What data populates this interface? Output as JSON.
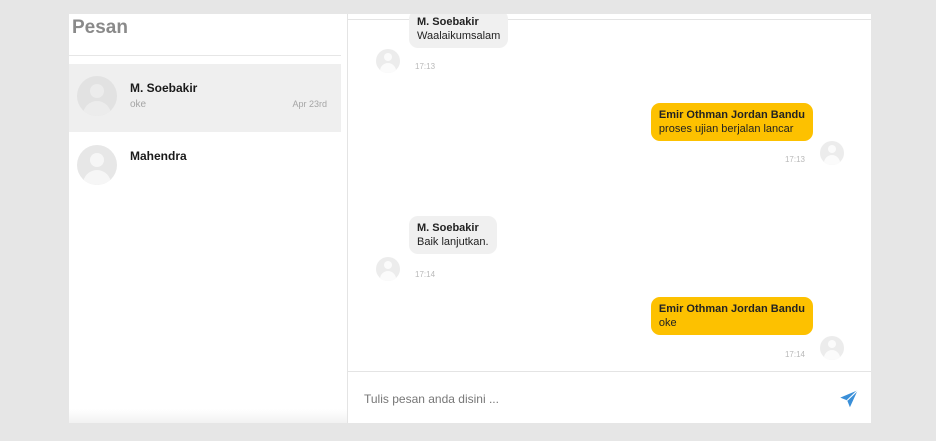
{
  "sidebar": {
    "title": "Pesan",
    "contacts": [
      {
        "name": "M. Soebakir",
        "preview": "oke",
        "date": "Apr 23rd"
      },
      {
        "name": "Mahendra",
        "preview": "",
        "date": ""
      }
    ]
  },
  "chat": {
    "messages": [
      {
        "direction": "in",
        "sender": "M. Soebakir",
        "text": "Waalaikumsalam",
        "time": "17:13"
      },
      {
        "direction": "out",
        "sender": "Emir Othman Jordan Bandu",
        "text": "proses ujian berjalan lancar",
        "time": "17:13"
      },
      {
        "direction": "in",
        "sender": "M. Soebakir",
        "text": "Baik lanjutkan.",
        "time": "17:14"
      },
      {
        "direction": "out",
        "sender": "Emir Othman Jordan Bandu",
        "text": "oke",
        "time": "17:14"
      }
    ],
    "composer": {
      "placeholder": "Tulis pesan anda disini ..."
    },
    "send_icon": "send-icon"
  },
  "colors": {
    "accent": "#fdc100",
    "send": "#3a8fd8",
    "incoming_bubble": "#f0f0f0"
  }
}
